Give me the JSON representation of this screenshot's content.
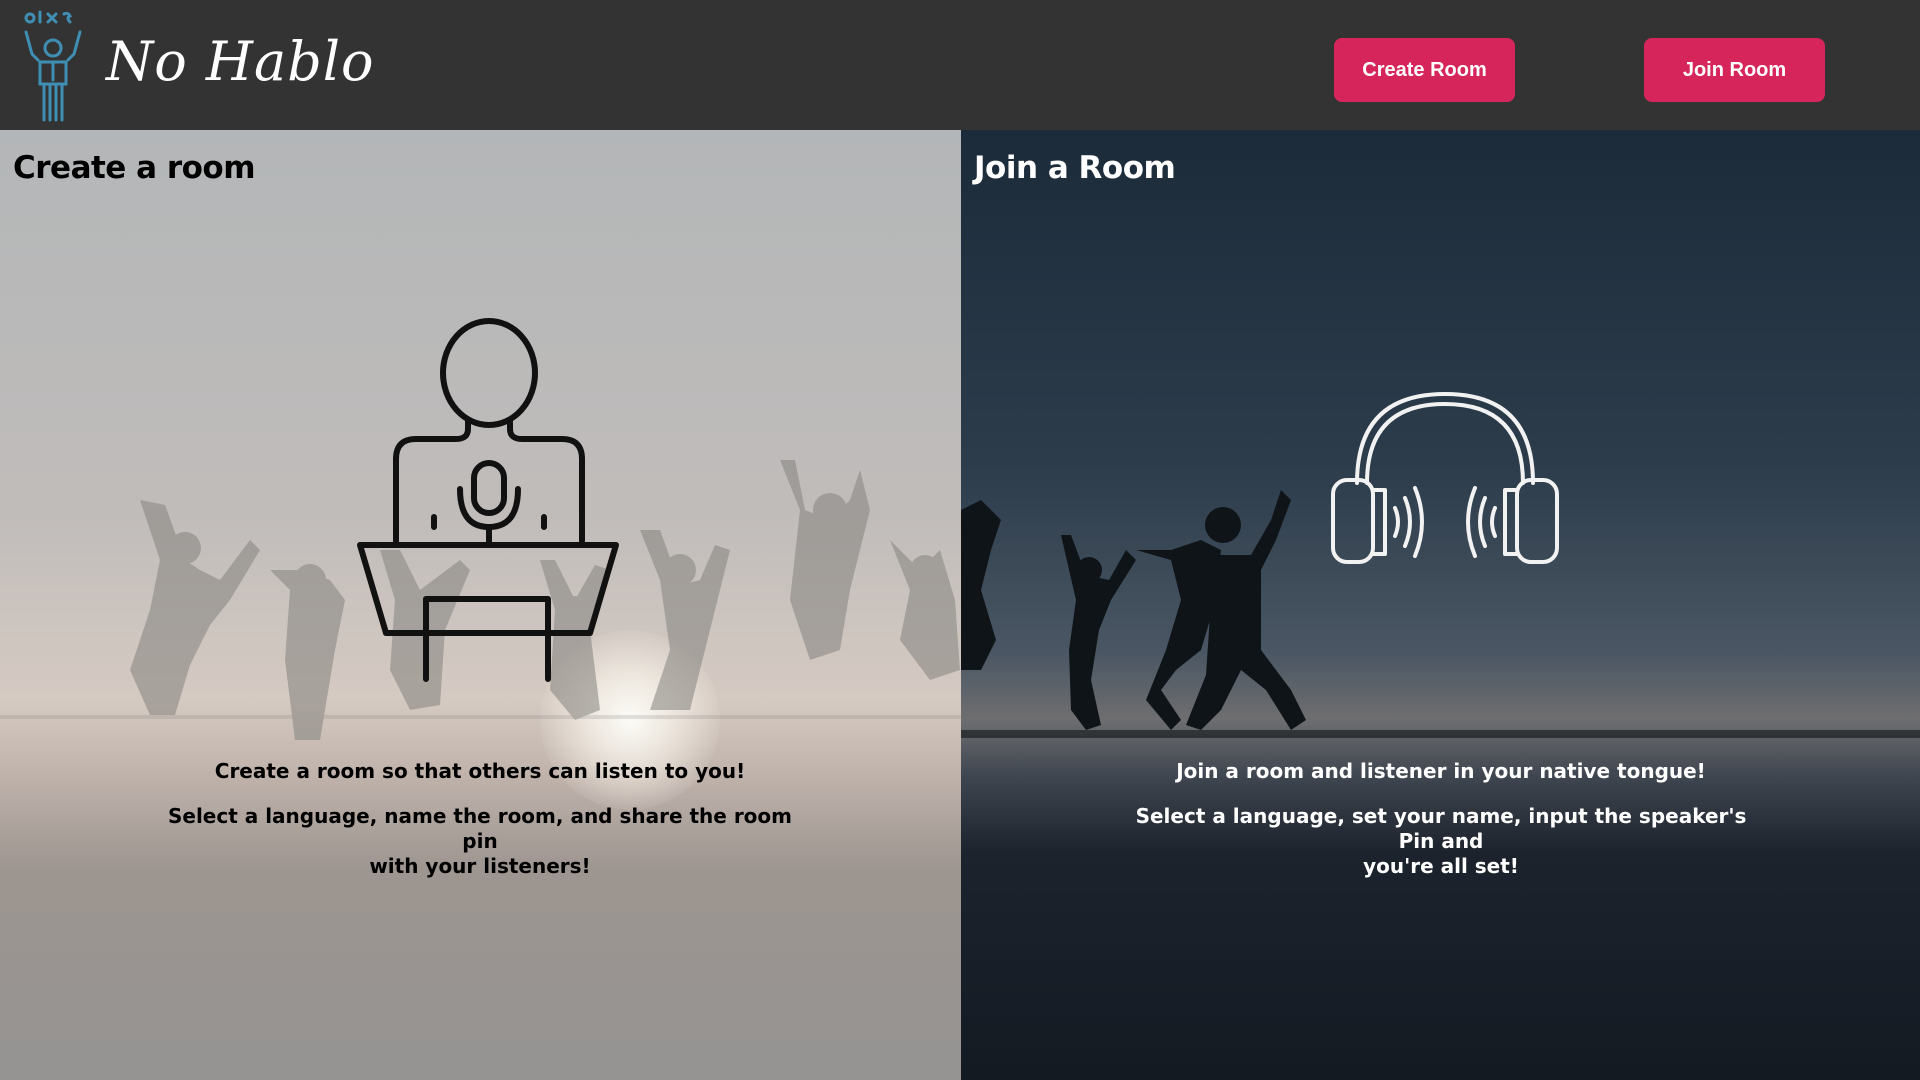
{
  "header": {
    "brand": "No Hablo",
    "logo_icon": "juggler-figure-icon",
    "create_room_label": "Create Room",
    "join_room_label": "Join Room",
    "accent_color": "#d6255a"
  },
  "create_panel": {
    "title": "Create a room",
    "icon": "speaker-podium-icon",
    "line1": "Create a room so that others can listen to you!",
    "line2a": "Select a language, name the room, and share the room pin",
    "line2b": "with your listeners!"
  },
  "join_panel": {
    "title": "Join a Room",
    "icon": "headphones-icon",
    "line1": "Join a room and listener in your native tongue!",
    "line2a": "Select a language, set your name, input the speaker's Pin and",
    "line2b": "you're all set!"
  }
}
